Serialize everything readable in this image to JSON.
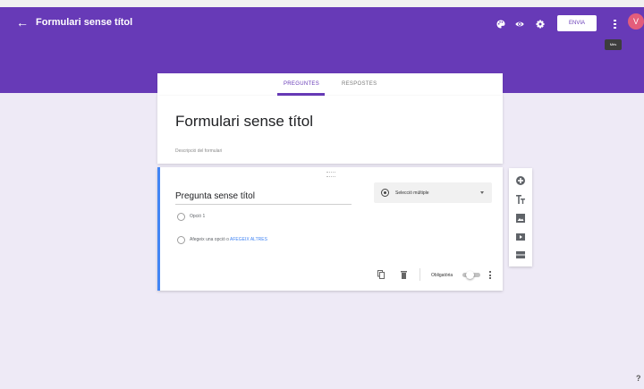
{
  "header": {
    "back_icon": "arrow-back-icon",
    "title": "Formulari sense títol",
    "icons": [
      "palette-icon",
      "eye-icon",
      "gear-icon"
    ],
    "send_label": "ENVIA",
    "more_icon": "more-vert-icon",
    "avatar_letter": "V",
    "tooltip": "Més"
  },
  "tabs": [
    {
      "label": "PREGUNTES",
      "active": true
    },
    {
      "label": "RESPOSTES",
      "active": false
    }
  ],
  "form": {
    "title": "Formulari sense títol",
    "description_placeholder": "Descripció del formulari"
  },
  "question": {
    "title": "Pregunta sense títol",
    "type": "Selecció múltiple",
    "options": [
      {
        "label": "Opció 1"
      },
      {
        "label": "Afegeix una opció o",
        "link": "AFEGEIX ALTRES"
      }
    ],
    "required_label": "Obligatòria",
    "required": false,
    "footer_icons": [
      "copy-icon",
      "delete-icon"
    ]
  },
  "side_tools": [
    "add-question-icon",
    "add-title-icon",
    "add-image-icon",
    "add-video-icon",
    "add-section-icon"
  ],
  "colors": {
    "accent": "#673ab7",
    "background": "#eeeaf6",
    "link": "#4285f4",
    "avatar": "#e35d7b"
  }
}
